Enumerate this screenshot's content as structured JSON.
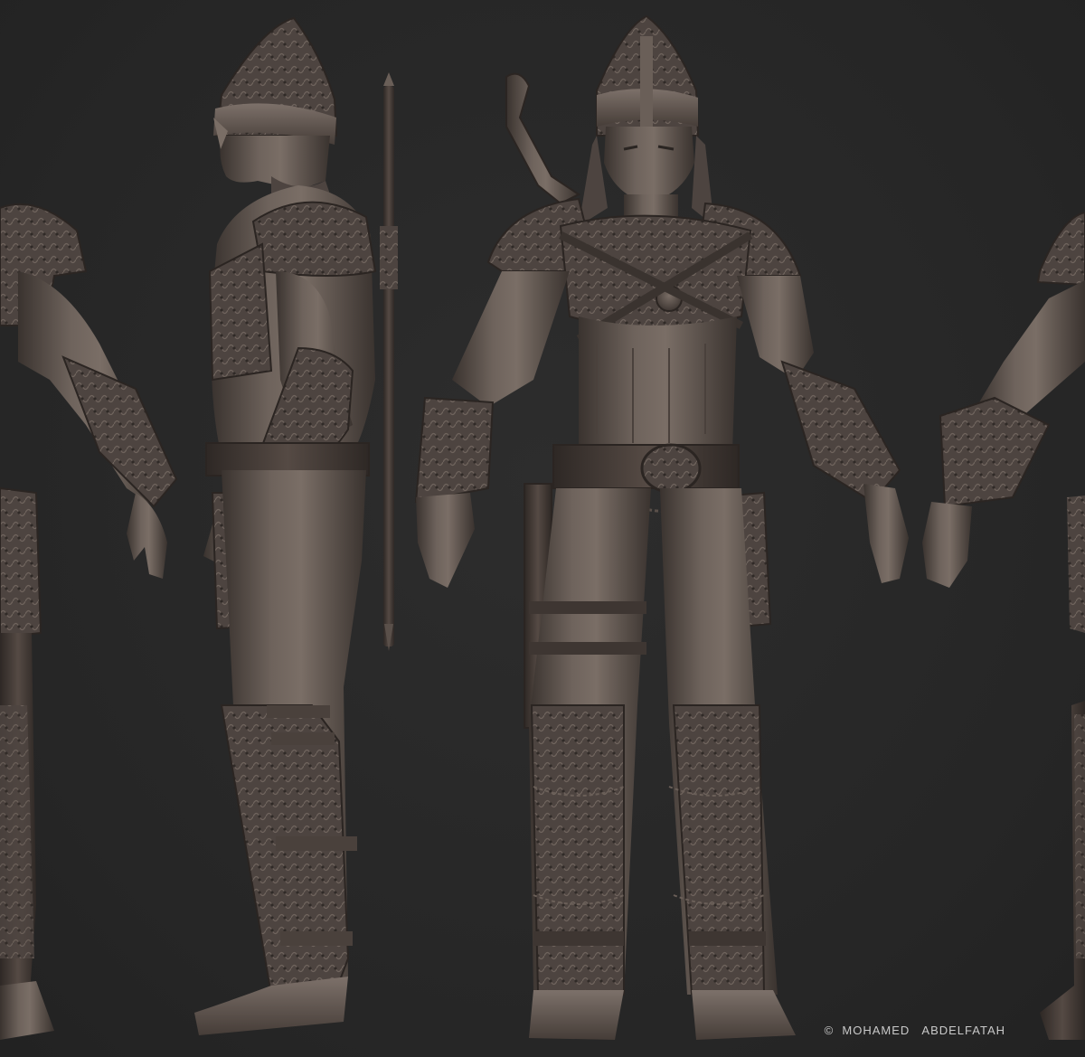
{
  "artwork": {
    "credit": "©  MOHAMED   ABDELFATAH"
  },
  "palette": {
    "background": "#282828",
    "clay_light": "#7a6e66",
    "clay_mid": "#5a504a",
    "clay_dark": "#3a332f",
    "clay_shadow": "#2a2522"
  }
}
